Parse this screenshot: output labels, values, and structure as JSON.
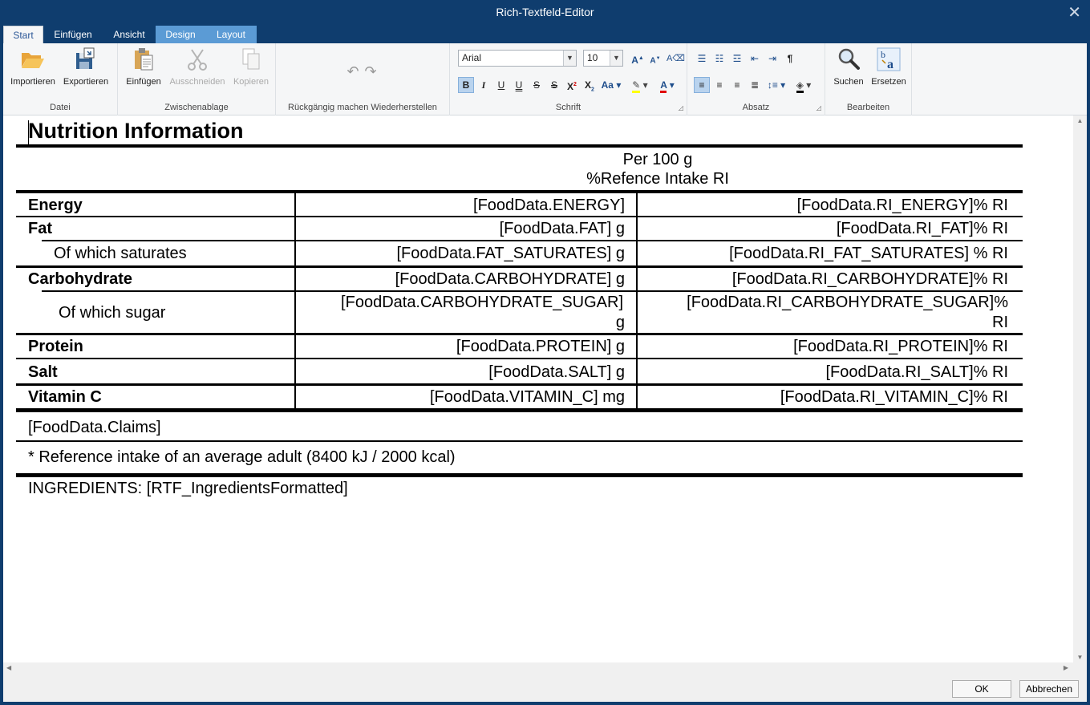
{
  "window": {
    "title": "Rich-Textfeld-Editor"
  },
  "tabs": [
    "Start",
    "Einfügen",
    "Ansicht",
    "Design",
    "Layout"
  ],
  "ribbon": {
    "datei": {
      "label": "Datei",
      "importieren": "Importieren",
      "exportieren": "Exportieren"
    },
    "zwischenablage": {
      "label": "Zwischenablage",
      "einfuegen": "Einfügen",
      "ausschneiden": "Ausschneiden",
      "kopieren": "Kopieren"
    },
    "undo": {
      "label": "Rückgängig machen Wiederherstellen"
    },
    "schrift": {
      "label": "Schrift",
      "font": "Arial",
      "size": "10"
    },
    "absatz": {
      "label": "Absatz"
    },
    "bearbeiten": {
      "label": "Bearbeiten",
      "suchen": "Suchen",
      "ersetzen": "Ersetzen"
    }
  },
  "document": {
    "heading": "Nutrition Information",
    "per": "Per 100 g",
    "ri": "%Refence Intake RI",
    "rows": [
      {
        "label": "Energy",
        "value": "[FoodData.ENERGY]",
        "ri": "[FoodData.RI_ENERGY]% RI"
      },
      {
        "label": "Fat",
        "value": "[FoodData.FAT] g",
        "ri": "[FoodData.RI_FAT]% RI"
      },
      {
        "label": "Of which saturates",
        "value": "[FoodData.FAT_SATURATES] g",
        "ri": "[FoodData.RI_FAT_SATURATES] % RI"
      },
      {
        "label": "Carbohydrate",
        "value": "[FoodData.CARBOHYDRATE] g",
        "ri": "[FoodData.RI_CARBOHYDRATE]% RI"
      },
      {
        "label": "Of which sugar",
        "value1": "[FoodData.CARBOHYDRATE_SUGAR]",
        "value2": "g",
        "ri1": "[FoodData.RI_CARBOHYDRATE_SUGAR]%",
        "ri2": "RI"
      },
      {
        "label": "Protein",
        "value": "[FoodData.PROTEIN] g",
        "ri": "[FoodData.RI_PROTEIN]% RI"
      },
      {
        "label": "Salt",
        "value": "[FoodData.SALT] g",
        "ri": "[FoodData.RI_SALT]% RI"
      },
      {
        "label": "Vitamin C",
        "value": "[FoodData.VITAMIN_C] mg",
        "ri": "[FoodData.RI_VITAMIN_C]% RI"
      }
    ],
    "claims": "[FoodData.Claims]",
    "footnote": "* Reference intake of an average adult (8400 kJ / 2000 kcal)",
    "ingredients": "INGREDIENTS: [RTF_IngredientsFormatted]"
  },
  "footer": {
    "ok": "OK",
    "cancel": "Abbrechen"
  }
}
